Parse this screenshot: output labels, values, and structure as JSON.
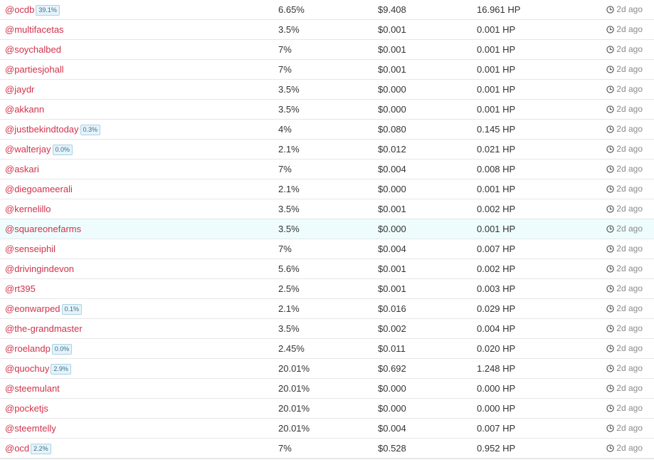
{
  "colors": {
    "voter_link": "#d0334c",
    "badge_bg": "#e5f3fa",
    "badge_border": "#a9d2e6",
    "highlight_row": "#eefcfd",
    "muted_text": "#8a8a8a"
  },
  "time_icon": "clock-icon",
  "votes": [
    {
      "voter": "@ocdb",
      "badge": "39.1%",
      "weight": "6.65%",
      "value": "$9.408",
      "hp": "16.961 HP",
      "time": "2d ago"
    },
    {
      "voter": "@multifacetas",
      "badge": "",
      "weight": "3.5%",
      "value": "$0.001",
      "hp": "0.001 HP",
      "time": "2d ago"
    },
    {
      "voter": "@soychalbed",
      "badge": "",
      "weight": "7%",
      "value": "$0.001",
      "hp": "0.001 HP",
      "time": "2d ago"
    },
    {
      "voter": "@partiesjohall",
      "badge": "",
      "weight": "7%",
      "value": "$0.001",
      "hp": "0.001 HP",
      "time": "2d ago"
    },
    {
      "voter": "@jaydr",
      "badge": "",
      "weight": "3.5%",
      "value": "$0.000",
      "hp": "0.001 HP",
      "time": "2d ago"
    },
    {
      "voter": "@akkann",
      "badge": "",
      "weight": "3.5%",
      "value": "$0.000",
      "hp": "0.001 HP",
      "time": "2d ago"
    },
    {
      "voter": "@justbekindtoday",
      "badge": "0.3%",
      "weight": "4%",
      "value": "$0.080",
      "hp": "0.145 HP",
      "time": "2d ago"
    },
    {
      "voter": "@walterjay",
      "badge": "0.0%",
      "weight": "2.1%",
      "value": "$0.012",
      "hp": "0.021 HP",
      "time": "2d ago"
    },
    {
      "voter": "@askari",
      "badge": "",
      "weight": "7%",
      "value": "$0.004",
      "hp": "0.008 HP",
      "time": "2d ago"
    },
    {
      "voter": "@diegoameerali",
      "badge": "",
      "weight": "2.1%",
      "value": "$0.000",
      "hp": "0.001 HP",
      "time": "2d ago"
    },
    {
      "voter": "@kernelillo",
      "badge": "",
      "weight": "3.5%",
      "value": "$0.001",
      "hp": "0.002 HP",
      "time": "2d ago"
    },
    {
      "voter": "@squareonefarms",
      "badge": "",
      "weight": "3.5%",
      "value": "$0.000",
      "hp": "0.001 HP",
      "time": "2d ago",
      "highlight": true
    },
    {
      "voter": "@senseiphil",
      "badge": "",
      "weight": "7%",
      "value": "$0.004",
      "hp": "0.007 HP",
      "time": "2d ago"
    },
    {
      "voter": "@drivingindevon",
      "badge": "",
      "weight": "5.6%",
      "value": "$0.001",
      "hp": "0.002 HP",
      "time": "2d ago"
    },
    {
      "voter": "@rt395",
      "badge": "",
      "weight": "2.5%",
      "value": "$0.001",
      "hp": "0.003 HP",
      "time": "2d ago"
    },
    {
      "voter": "@eonwarped",
      "badge": "0.1%",
      "weight": "2.1%",
      "value": "$0.016",
      "hp": "0.029 HP",
      "time": "2d ago"
    },
    {
      "voter": "@the-grandmaster",
      "badge": "",
      "weight": "3.5%",
      "value": "$0.002",
      "hp": "0.004 HP",
      "time": "2d ago"
    },
    {
      "voter": "@roelandp",
      "badge": "0.0%",
      "weight": "2.45%",
      "value": "$0.011",
      "hp": "0.020 HP",
      "time": "2d ago"
    },
    {
      "voter": "@quochuy",
      "badge": "2.9%",
      "weight": "20.01%",
      "value": "$0.692",
      "hp": "1.248 HP",
      "time": "2d ago"
    },
    {
      "voter": "@steemulant",
      "badge": "",
      "weight": "20.01%",
      "value": "$0.000",
      "hp": "0.000 HP",
      "time": "2d ago"
    },
    {
      "voter": "@pocketjs",
      "badge": "",
      "weight": "20.01%",
      "value": "$0.000",
      "hp": "0.000 HP",
      "time": "2d ago"
    },
    {
      "voter": "@steemtelly",
      "badge": "",
      "weight": "20.01%",
      "value": "$0.004",
      "hp": "0.007 HP",
      "time": "2d ago"
    },
    {
      "voter": "@ocd",
      "badge": "2.2%",
      "weight": "7%",
      "value": "$0.528",
      "hp": "0.952 HP",
      "time": "2d ago"
    }
  ]
}
